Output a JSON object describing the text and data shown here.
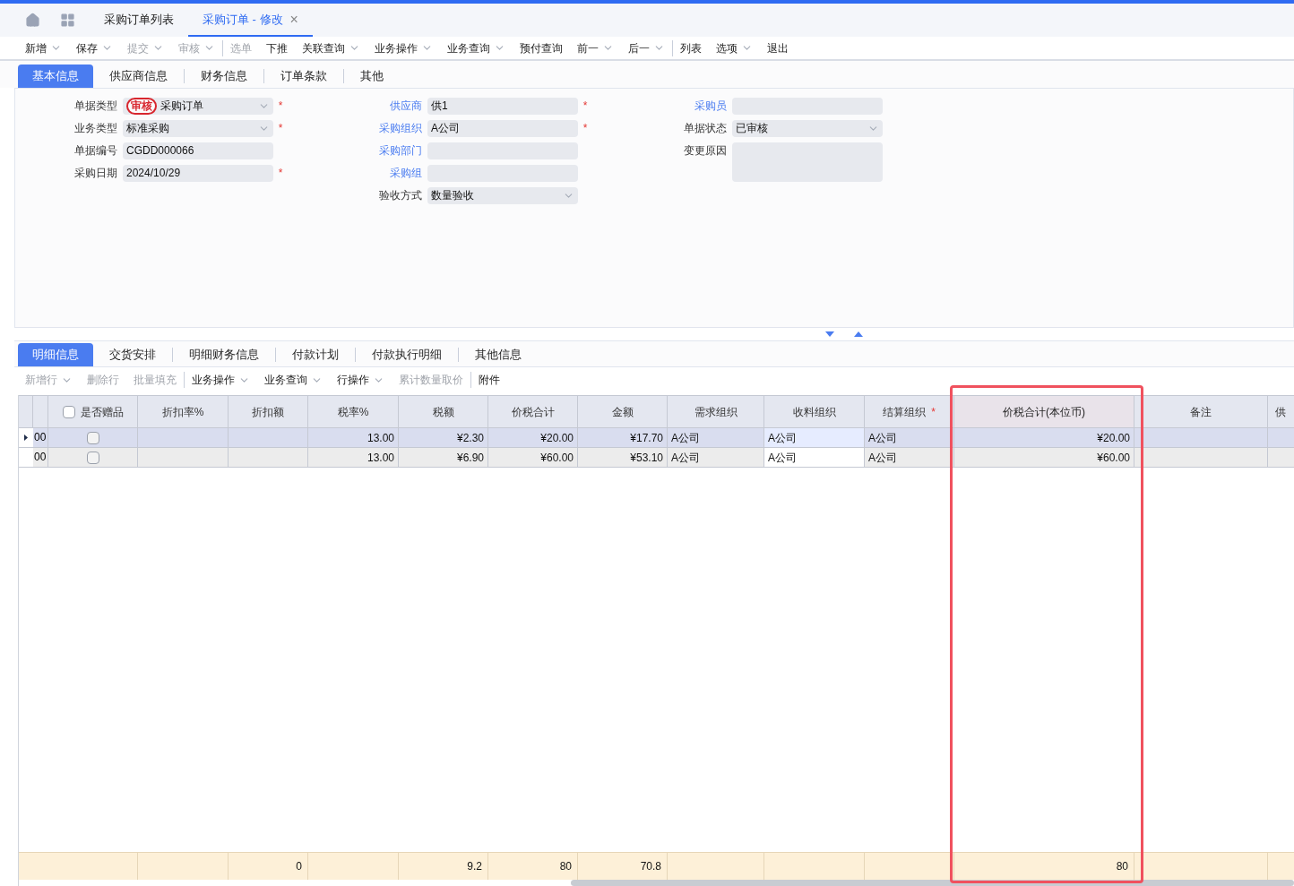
{
  "window_tabs": [
    {
      "label": "采购订单列表",
      "selected": false,
      "closable": false
    },
    {
      "label": "采购订单 - 修改",
      "selected": true,
      "closable": true,
      "close": "×"
    }
  ],
  "toolbar": [
    [
      {
        "label": "新增",
        "dropdown": true,
        "disabled": false
      },
      {
        "label": "保存",
        "dropdown": true,
        "disabled": false
      },
      {
        "label": "提交",
        "dropdown": true,
        "disabled": true
      },
      {
        "label": "审核",
        "dropdown": true,
        "disabled": true
      }
    ],
    [
      {
        "label": "选单",
        "dropdown": false,
        "disabled": true
      },
      {
        "label": "下推",
        "dropdown": false,
        "disabled": false
      },
      {
        "label": "关联查询",
        "dropdown": true,
        "disabled": false
      },
      {
        "label": "业务操作",
        "dropdown": true,
        "disabled": false
      },
      {
        "label": "业务查询",
        "dropdown": true,
        "disabled": false
      },
      {
        "label": "预付查询",
        "dropdown": false,
        "disabled": false
      },
      {
        "label": "前一",
        "dropdown": true,
        "disabled": false
      },
      {
        "label": "后一",
        "dropdown": true,
        "disabled": false
      }
    ],
    [
      {
        "label": "列表",
        "dropdown": false,
        "disabled": false
      },
      {
        "label": "选项",
        "dropdown": true,
        "disabled": false
      },
      {
        "label": "退出",
        "dropdown": false,
        "disabled": false
      }
    ]
  ],
  "header_tabs": [
    {
      "label": "基本信息",
      "selected": true
    },
    {
      "label": "供应商信息",
      "selected": false
    },
    {
      "label": "财务信息",
      "selected": false
    },
    {
      "label": "订单条款",
      "selected": false
    },
    {
      "label": "其他",
      "selected": false
    }
  ],
  "stamp": {
    "text": "审核"
  },
  "form": [
    [
      {
        "label": "单据类型",
        "value": "采购订单",
        "kind": "select",
        "link": false,
        "required_mark": "*"
      },
      {
        "label": "业务类型",
        "value": "标准采购",
        "kind": "select",
        "link": false,
        "required_mark": "*"
      },
      {
        "label": "单据编号",
        "value": "CGDD000066",
        "kind": "text",
        "link": false
      },
      {
        "label": "采购日期",
        "value": "2024/10/29",
        "kind": "text",
        "link": false,
        "required_mark": "*"
      }
    ],
    [
      {
        "label": "供应商",
        "value": "供1",
        "kind": "text",
        "link": true,
        "required_mark": "*"
      },
      {
        "label": "采购组织",
        "value": "A公司",
        "kind": "text",
        "link": true,
        "required_mark": "*"
      },
      {
        "label": "采购部门",
        "kind": "text",
        "link": true
      },
      {
        "label": "采购组",
        "kind": "text",
        "link": true
      },
      {
        "label": "验收方式",
        "value": "数量验收",
        "kind": "select",
        "link": false
      }
    ],
    [
      {
        "label": "采购员",
        "kind": "text",
        "link": true
      },
      {
        "label": "单据状态",
        "value": "已审核",
        "kind": "select",
        "link": false
      },
      {
        "label": "变更原因",
        "kind": "textarea",
        "link": false
      }
    ]
  ],
  "detail_tabs": [
    {
      "label": "明细信息",
      "selected": true
    },
    {
      "label": "交货安排",
      "selected": false
    },
    {
      "label": "明细财务信息",
      "selected": false
    },
    {
      "label": "付款计划",
      "selected": false
    },
    {
      "label": "付款执行明细",
      "selected": false
    },
    {
      "label": "其他信息",
      "selected": false
    }
  ],
  "detail_toolbar": [
    [
      {
        "label": "新增行",
        "dropdown": true,
        "disabled": true
      },
      {
        "label": "删除行",
        "dropdown": false,
        "disabled": true
      },
      {
        "label": "批量填充",
        "dropdown": false,
        "disabled": true
      }
    ],
    [
      {
        "label": "业务操作",
        "dropdown": true,
        "disabled": false
      },
      {
        "label": "业务查询",
        "dropdown": true,
        "disabled": false
      },
      {
        "label": "行操作",
        "dropdown": true,
        "disabled": false
      },
      {
        "label": "累计数量取价",
        "dropdown": false,
        "disabled": true
      }
    ],
    [
      {
        "label": "附件",
        "dropdown": false,
        "disabled": false
      }
    ]
  ],
  "grid": {
    "columns": [
      {
        "label": "是否赠品",
        "kind": "check",
        "highlighted": false,
        "checked": false
      },
      {
        "label": "折扣率%",
        "kind": "number",
        "highlighted": false
      },
      {
        "label": "折扣额",
        "kind": "number",
        "highlighted": false,
        "total": "0"
      },
      {
        "label": "税率%",
        "kind": "number",
        "highlighted": false
      },
      {
        "label": "税额",
        "kind": "number",
        "highlighted": false,
        "total": "9.2"
      },
      {
        "label": "价税合计",
        "kind": "number",
        "highlighted": false,
        "total": "80"
      },
      {
        "label": "金额",
        "kind": "number",
        "highlighted": false,
        "total": "70.8"
      },
      {
        "label": "需求组织",
        "kind": "text",
        "highlighted": false
      },
      {
        "label": "收料组织",
        "kind": "input",
        "highlighted": false
      },
      {
        "label": "结算组织",
        "kind": "text",
        "required_mark": "*",
        "highlighted": false
      },
      {
        "label": "价税合计(本位币)",
        "kind": "number",
        "highlighted": true,
        "total": "80"
      },
      {
        "label": "备注",
        "kind": "text",
        "highlighted": false
      },
      {
        "label": "供",
        "kind": "text",
        "highlighted": false
      }
    ],
    "rows": [
      {
        "selected": true,
        "seq": "00",
        "cells": [
          {
            "checked": false
          },
          "",
          "",
          "13.00",
          "¥2.30",
          "¥20.00",
          "¥17.70",
          "A公司",
          "A公司",
          "A公司",
          "¥20.00",
          "",
          ""
        ]
      },
      {
        "selected": false,
        "seq": "00",
        "cells": [
          {
            "checked": false
          },
          "",
          "",
          "13.00",
          "¥6.90",
          "¥60.00",
          "¥53.10",
          "A公司",
          "A公司",
          "A公司",
          "¥60.00",
          "",
          ""
        ]
      }
    ]
  }
}
